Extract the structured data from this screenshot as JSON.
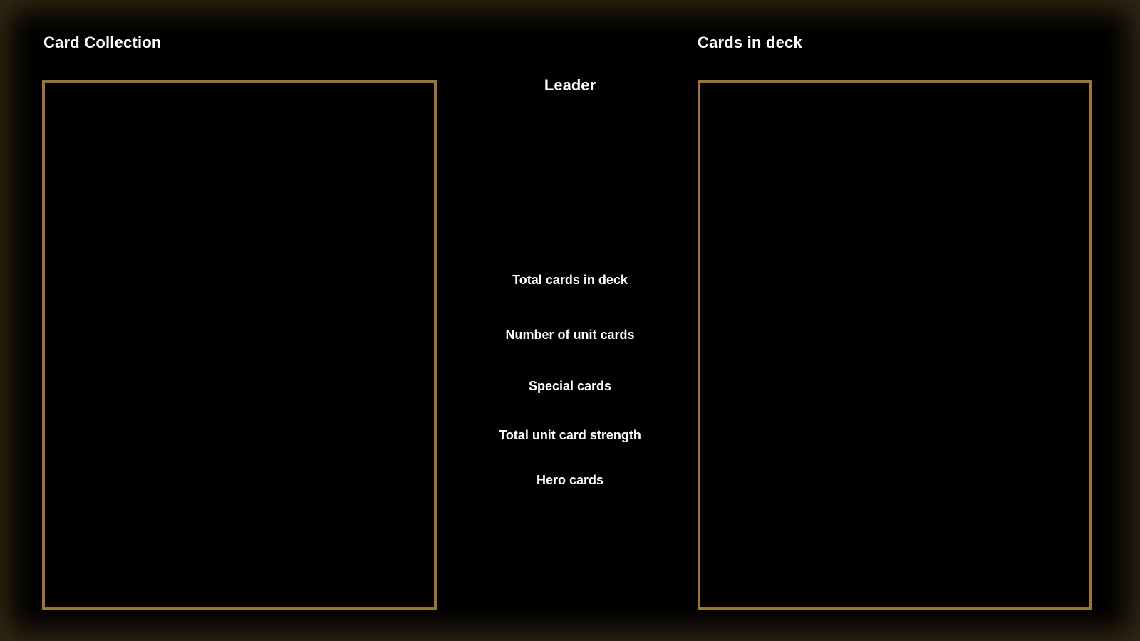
{
  "collection": {
    "title": "Card Collection",
    "cards": []
  },
  "deck": {
    "title": "Cards in deck",
    "cards": []
  },
  "leader": {
    "label": "Leader"
  },
  "stats": {
    "total_cards_label": "Total cards in deck",
    "unit_cards_label": "Number of unit cards",
    "special_cards_label": "Special cards",
    "unit_strength_label": "Total unit card strength",
    "hero_cards_label": "Hero cards"
  },
  "colors": {
    "background": "#000000",
    "panel_border": "#9b7535",
    "vignette": "#5c4824",
    "text": "#ffffff"
  }
}
